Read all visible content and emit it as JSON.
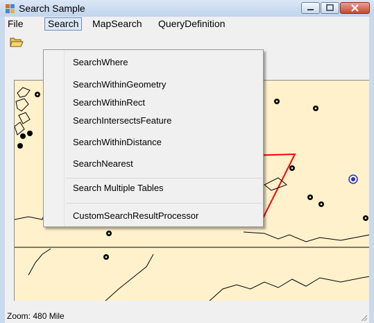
{
  "window": {
    "title": "Search Sample"
  },
  "menubar": {
    "items": [
      "File",
      "Search",
      "MapSearch",
      "QueryDefinition"
    ]
  },
  "search_menu": {
    "items": [
      "SearchWhere",
      "SearchWithinGeometry",
      "SearchWithinRect",
      "SearchIntersectsFeature",
      "SearchWithinDistance",
      "SearchNearest",
      "Search Multiple Tables",
      "CustomSearchResultProcessor"
    ]
  },
  "status": {
    "zoom": "Zoom: 480 Mile"
  },
  "colors": {
    "map_background": "#fff1cb",
    "selection_outline": "#ff0000",
    "highlight_marker": "#2233cc"
  }
}
